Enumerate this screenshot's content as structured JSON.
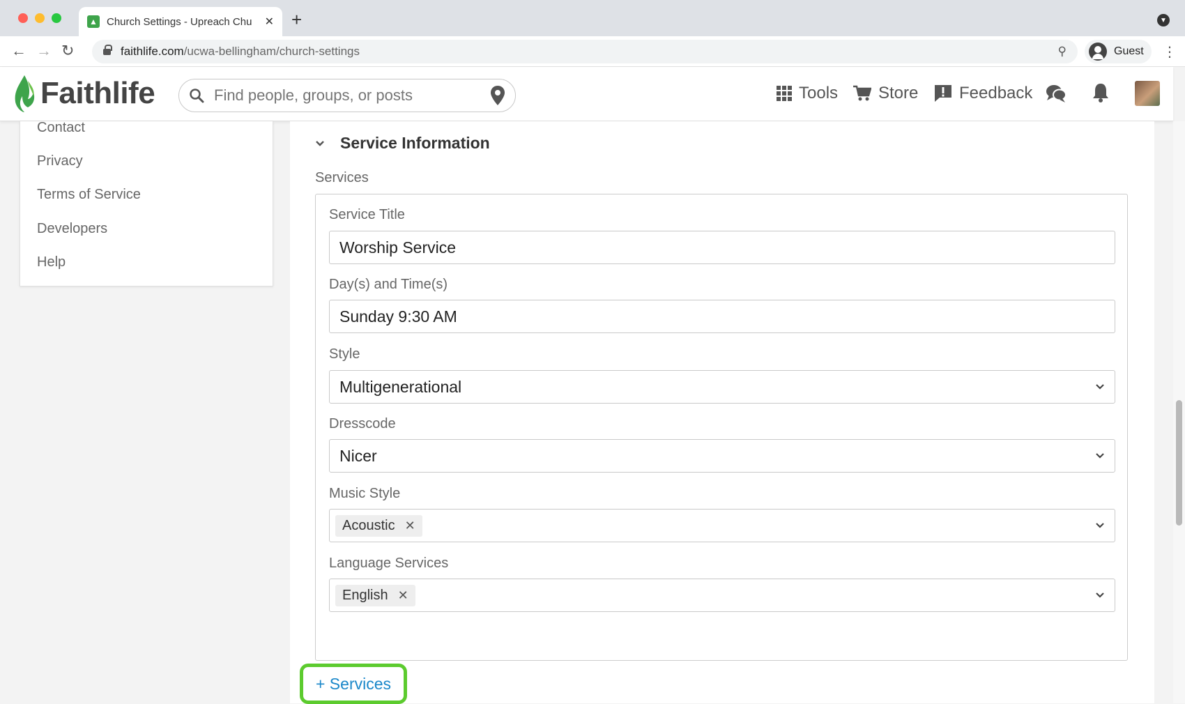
{
  "browser": {
    "tab_title": "Church Settings - Upreach Chu",
    "url_host": "faithlife.com",
    "url_path": "/ucwa-bellingham/church-settings",
    "profile_label": "Guest"
  },
  "header": {
    "logo_text": "Faithlife",
    "search_placeholder": "Find people, groups, or posts",
    "nav": {
      "tools": "Tools",
      "store": "Store",
      "feedback": "Feedback"
    }
  },
  "sidebar": {
    "links": [
      "Contact",
      "Privacy",
      "Terms of Service",
      "Developers",
      "Help"
    ]
  },
  "main": {
    "section_title": "Service Information",
    "services_label": "Services",
    "fields": {
      "service_title_label": "Service Title",
      "service_title_value": "Worship Service",
      "day_time_label": "Day(s) and Time(s)",
      "day_time_value": "Sunday 9:30 AM",
      "style_label": "Style",
      "style_value": "Multigenerational",
      "dresscode_label": "Dresscode",
      "dresscode_value": "Nicer",
      "music_style_label": "Music Style",
      "music_style_chip": "Acoustic",
      "language_label": "Language Services",
      "language_chip": "English"
    },
    "add_services_label": "+ Services"
  },
  "colors": {
    "brand_green": "#3ea44b",
    "link_blue": "#1a87c9",
    "highlight_green": "#5ccb2e"
  }
}
